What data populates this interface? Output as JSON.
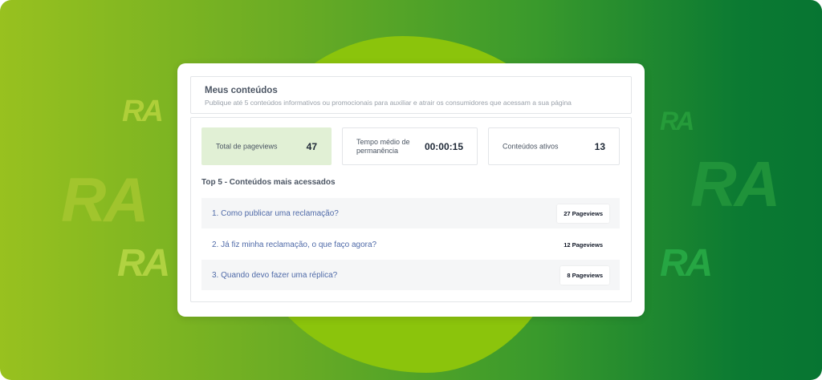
{
  "background": {
    "watermark_text": "RA",
    "colors": {
      "gradient_start": "#98c11f",
      "gradient_end": "#077532",
      "blob": "#8bc40c"
    }
  },
  "card": {
    "title": "Meus conteúdos",
    "subtitle": "Publique até 5 conteúdos informativos ou promocionais para auxiliar e atrair os consumidores que acessam a sua página"
  },
  "stats": [
    {
      "label": "Total de pageviews",
      "value": "47"
    },
    {
      "label": "Tempo médio de permanência",
      "value": "00:00:15"
    },
    {
      "label": "Conteúdos ativos",
      "value": "13"
    }
  ],
  "top": {
    "title": "Top 5 - Conteúdos mais acessados",
    "items": [
      {
        "label": "1. Como publicar uma reclamação?",
        "pageviews": "27 Pageviews"
      },
      {
        "label": "2. Já fiz minha reclamação, o que faço agora?",
        "pageviews": "12 Pageviews"
      },
      {
        "label": "3. Quando devo fazer uma réplica?",
        "pageviews": "8 Pageviews"
      }
    ]
  },
  "colors": {
    "accent_link": "#4f6aa8",
    "highlight_stat": "#e1f0d5"
  }
}
